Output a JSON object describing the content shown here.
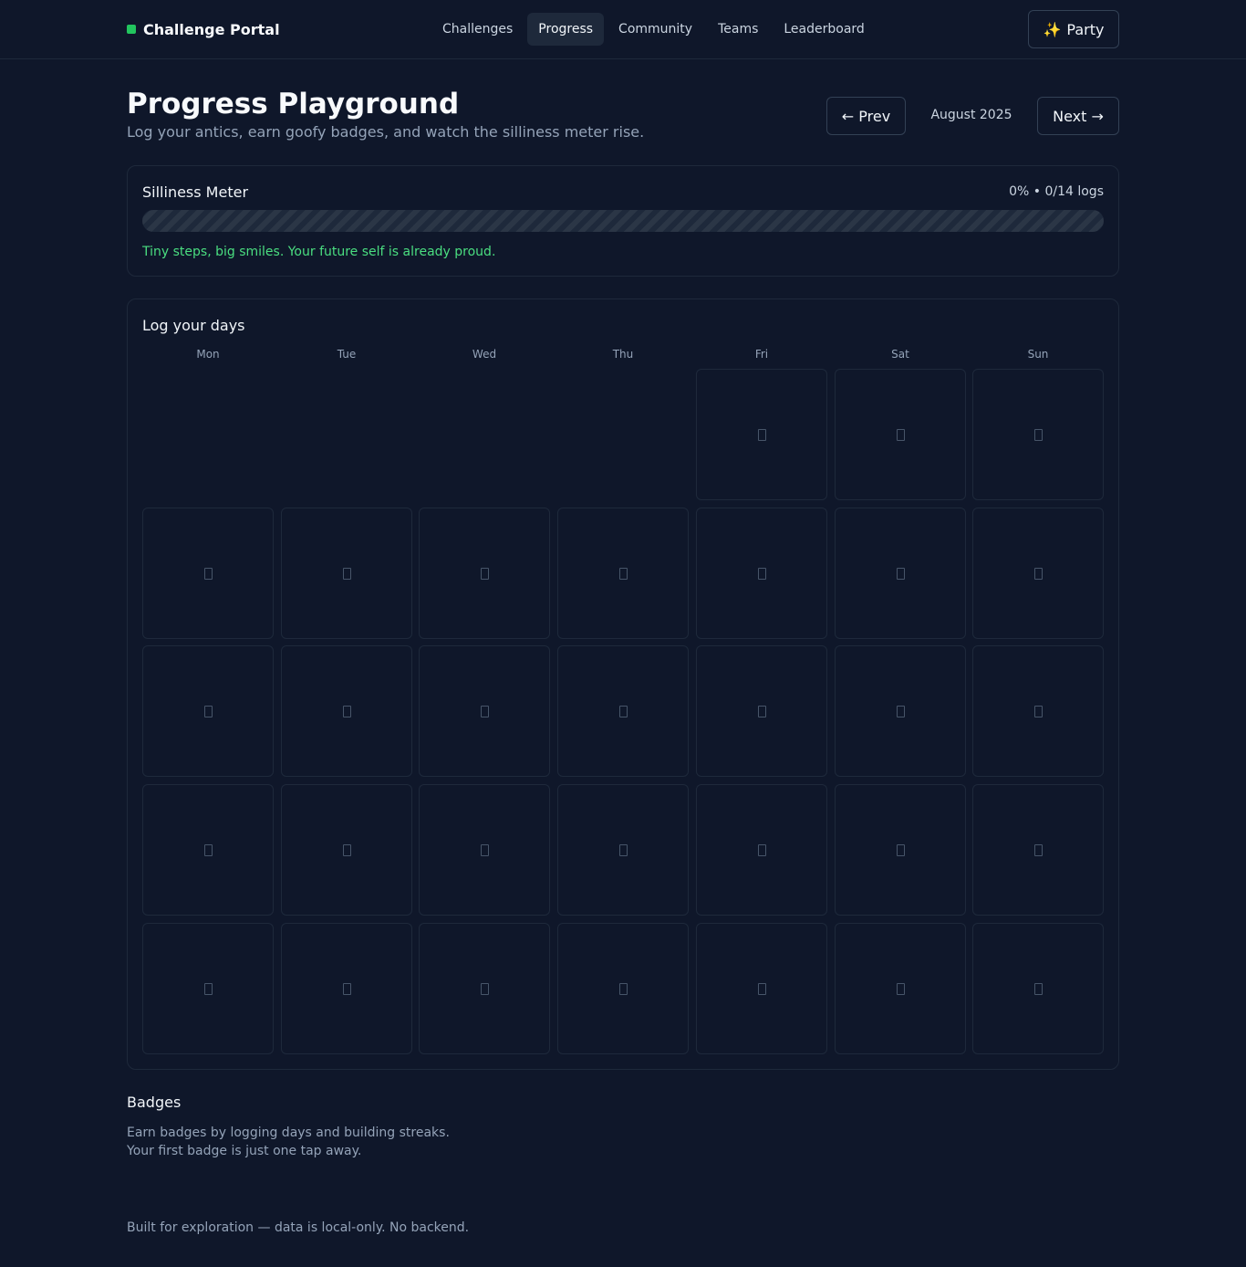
{
  "header": {
    "brand": "Challenge Portal",
    "nav": [
      {
        "label": "Challenges",
        "active": false
      },
      {
        "label": "Progress",
        "active": true
      },
      {
        "label": "Community",
        "active": false
      },
      {
        "label": "Teams",
        "active": false
      },
      {
        "label": "Leaderboard",
        "active": false
      }
    ],
    "party_icon": "✨",
    "party_label": "Party"
  },
  "page": {
    "title": "Progress Playground",
    "subtitle": "Log your antics, earn goofy badges, and watch the silliness meter rise.",
    "prev_label": "← Prev",
    "month": "August 2025",
    "next_label": "Next →"
  },
  "meter": {
    "title": "Silliness Meter",
    "stats": "0% • 0/14 logs",
    "progress": 0,
    "message": "Tiny steps, big smiles. Your future self is already proud."
  },
  "calendar": {
    "title": "Log your days",
    "weekdays": [
      "Mon",
      "Tue",
      "Wed",
      "Thu",
      "Fri",
      "Sat",
      "Sun"
    ],
    "first_weekday_index": 4,
    "days_in_month": 31,
    "day_icon": "empty-box-icon"
  },
  "badges": {
    "title": "Badges",
    "line1": "Earn badges by logging days and building streaks.",
    "line2": "Your first badge is just one tap away."
  },
  "footer": "Built for exploration — data is local-only. No backend.",
  "colors": {
    "background": "#0f172a",
    "border": "#1e293b",
    "accent": "#22c55e",
    "message": "#4ade80"
  }
}
